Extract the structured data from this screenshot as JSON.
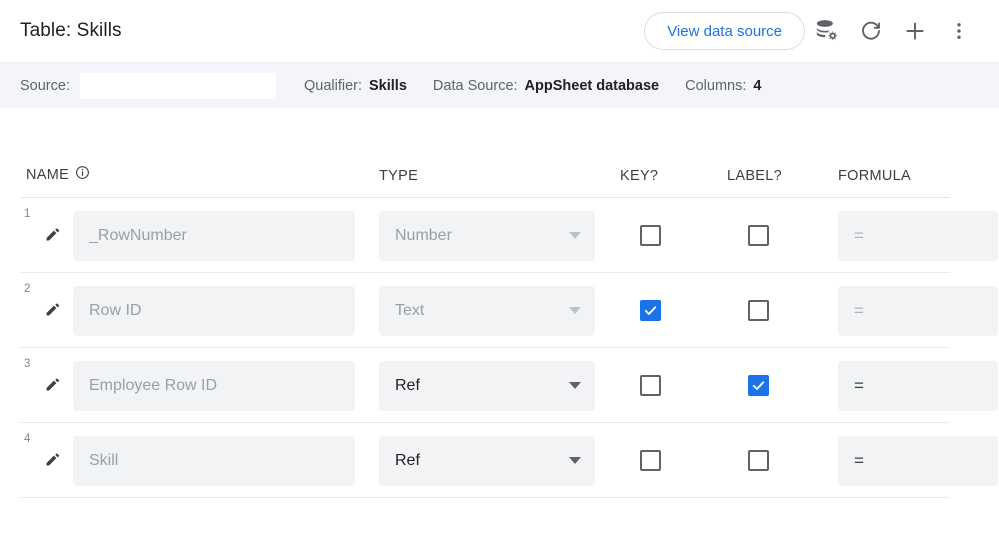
{
  "topbar": {
    "title": "Table: Skills",
    "view_data_source_label": "View data source",
    "icons": [
      {
        "name": "database-settings-icon",
        "title": "Data source settings"
      },
      {
        "name": "refresh-icon",
        "title": "Regenerate"
      },
      {
        "name": "plus-icon",
        "title": "Add"
      },
      {
        "name": "more-vert-icon",
        "title": "More"
      }
    ],
    "accent_color": "#1a73e8"
  },
  "infobar": {
    "source_label": "Source:",
    "source_value": "",
    "source_placeholder": "",
    "qualifier_label": "Qualifier:",
    "qualifier_value": "Skills",
    "data_source_label": "Data Source:",
    "data_source_value": "AppSheet database",
    "columns_label": "Columns:",
    "columns_value": "4",
    "background_color": "#f3f5fb"
  },
  "table": {
    "headers": {
      "name": "NAME",
      "name_info_icon": "info-icon",
      "type": "TYPE",
      "key": "KEY?",
      "label": "LABEL?",
      "formula": "FORMULA"
    },
    "rows": [
      {
        "number": "1",
        "name": "_RowNumber",
        "name_enabled": false,
        "type": "Number",
        "type_enabled": false,
        "key_checked": false,
        "label_checked": false,
        "formula": "=",
        "formula_enabled": false
      },
      {
        "number": "2",
        "name": "Row ID",
        "name_enabled": false,
        "type": "Text",
        "type_enabled": false,
        "key_checked": true,
        "label_checked": false,
        "formula": "=",
        "formula_enabled": false
      },
      {
        "number": "3",
        "name": "Employee Row ID",
        "name_enabled": false,
        "type": "Ref",
        "type_enabled": true,
        "key_checked": false,
        "label_checked": true,
        "formula": "=",
        "formula_enabled": true
      },
      {
        "number": "4",
        "name": "Skill",
        "name_enabled": false,
        "type": "Ref",
        "type_enabled": true,
        "key_checked": false,
        "label_checked": false,
        "formula": "=",
        "formula_enabled": true
      }
    ]
  }
}
